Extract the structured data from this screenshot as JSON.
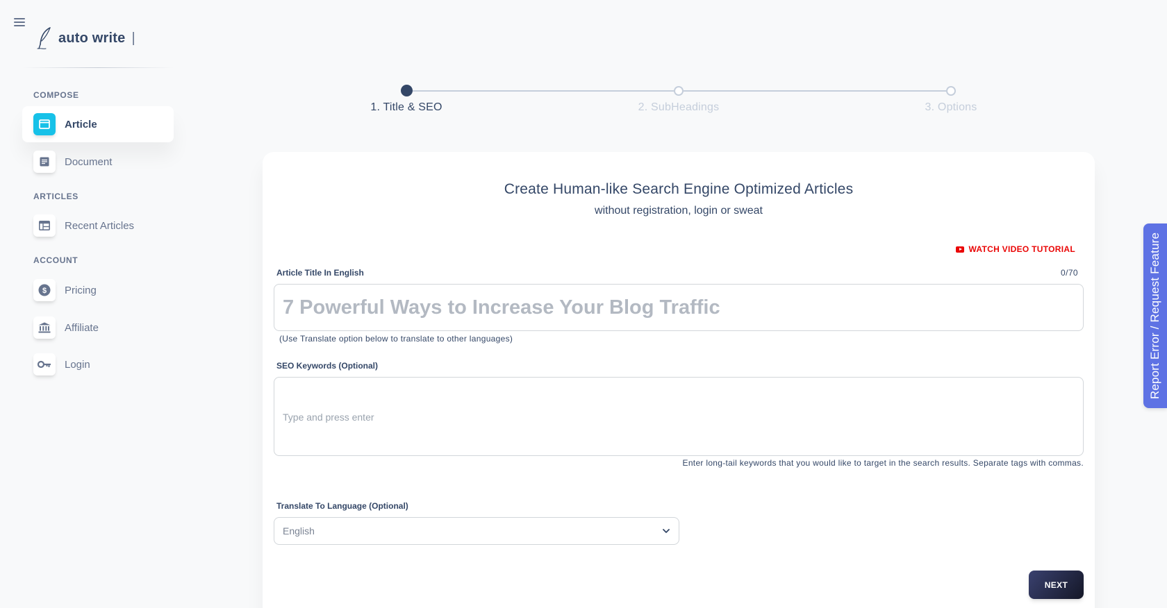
{
  "brand": {
    "name": "auto write",
    "cursor": "|"
  },
  "sidebar": {
    "sections": {
      "compose": "COMPOSE",
      "articles": "ARTICLES",
      "account": "ACCOUNT"
    },
    "items": [
      {
        "label": "Article",
        "icon": "browser-window-icon",
        "active": true
      },
      {
        "label": "Document",
        "icon": "document-icon",
        "active": false
      },
      {
        "label": "Recent Articles",
        "icon": "table-icon",
        "active": false
      },
      {
        "label": "Pricing",
        "icon": "dollar-coin-icon",
        "active": false
      },
      {
        "label": "Affiliate",
        "icon": "bank-icon",
        "active": false
      },
      {
        "label": "Login",
        "icon": "key-icon",
        "active": false
      }
    ]
  },
  "stepper": {
    "steps": [
      {
        "label": "1. Title & SEO",
        "active": true
      },
      {
        "label": "2. SubHeadings",
        "active": false
      },
      {
        "label": "3. Options",
        "active": false
      }
    ]
  },
  "card": {
    "title": "Create Human-like Search Engine Optimized Articles",
    "subtitle": "without registration, login or sweat",
    "watch_video": "WATCH VIDEO TUTORIAL",
    "title_field": {
      "label": "Article Title In English",
      "counter": "0/70",
      "placeholder": "7 Powerful Ways to Increase Your Blog Traffic",
      "value": "",
      "hint": "(Use Translate option below to translate to other languages)"
    },
    "keywords_field": {
      "label": "SEO Keywords (Optional)",
      "placeholder": "Type and press enter",
      "hint": "Enter long-tail keywords that you would like to target in the search results. Separate tags with commas."
    },
    "language_field": {
      "label": "Translate To Language (Optional)",
      "selected": "English"
    },
    "next_button": "NEXT"
  },
  "report_tab": {
    "label": "Report Error / Request Feature"
  },
  "colors": {
    "primary_text": "#344767",
    "muted_text": "#67748e",
    "active_icon_bg": "#17c1e8",
    "watch_link": "#ea0606",
    "report_tab": "#5e72e4",
    "next_button": "#141727"
  }
}
